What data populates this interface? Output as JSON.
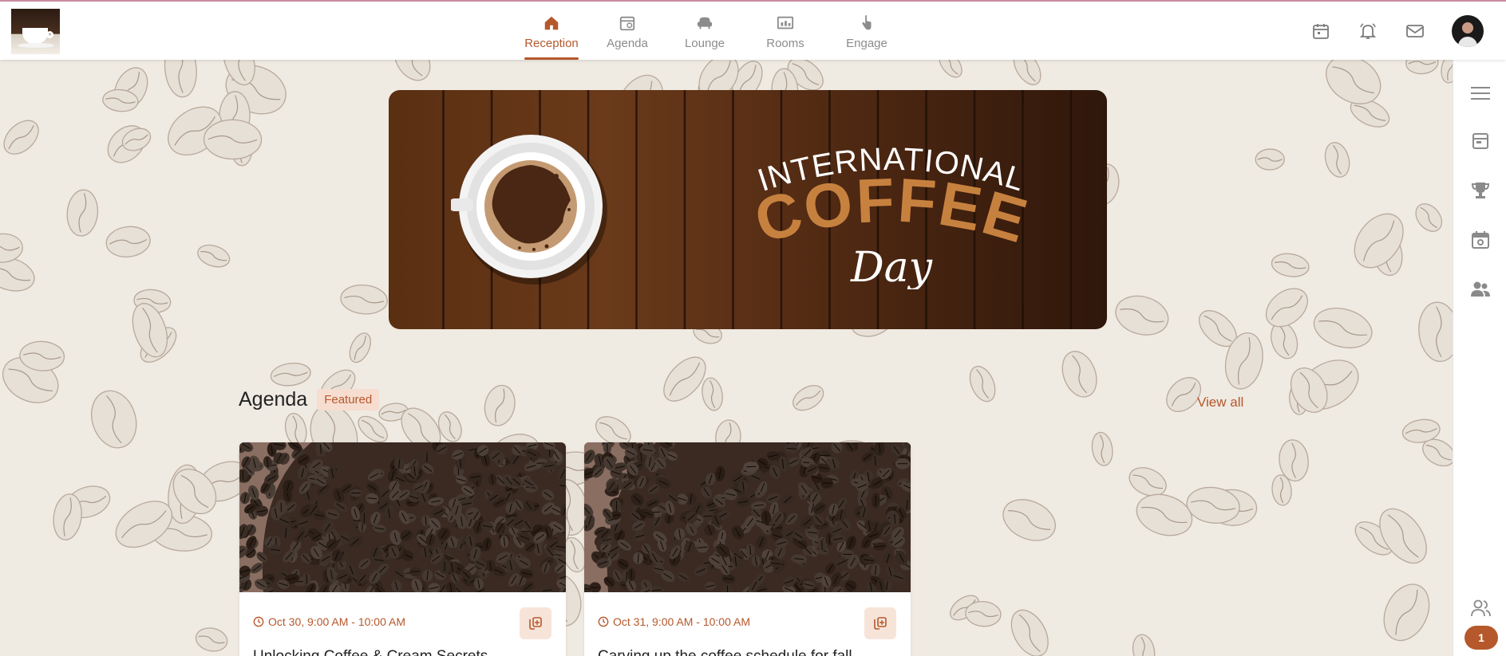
{
  "topbar": {
    "nav": [
      {
        "label": "Reception",
        "icon": "home-icon",
        "active": true
      },
      {
        "label": "Agenda",
        "icon": "agenda-icon",
        "active": false
      },
      {
        "label": "Lounge",
        "icon": "lounge-icon",
        "active": false
      },
      {
        "label": "Rooms",
        "icon": "rooms-icon",
        "active": false
      },
      {
        "label": "Engage",
        "icon": "engage-icon",
        "active": false
      }
    ],
    "right_icons": [
      "calendar-icon",
      "notification-bell-icon",
      "mail-icon",
      "user-avatar"
    ]
  },
  "hero": {
    "line1": "INTERNATIONAL",
    "line2": "COFFEE",
    "line3": "Day"
  },
  "agenda": {
    "title": "Agenda",
    "tag": "Featured",
    "view_all": "View all",
    "cards": [
      {
        "time": "Oct 30, 9:00 AM - 10:00 AM",
        "title": "Unlocking Coffee & Cream Secrets"
      },
      {
        "time": "Oct 31, 9:00 AM - 10:00 AM",
        "title": "Carving up the coffee schedule for fall"
      }
    ]
  },
  "rail": {
    "icons": [
      "menu-icon",
      "schedule-card-icon",
      "trophy-icon",
      "event-calendar-icon",
      "people-icon",
      "attendees-icon"
    ],
    "badge": "1"
  },
  "colors": {
    "accent": "#b5582b",
    "background": "#efeae2",
    "hero_dark": "#2f170b"
  }
}
